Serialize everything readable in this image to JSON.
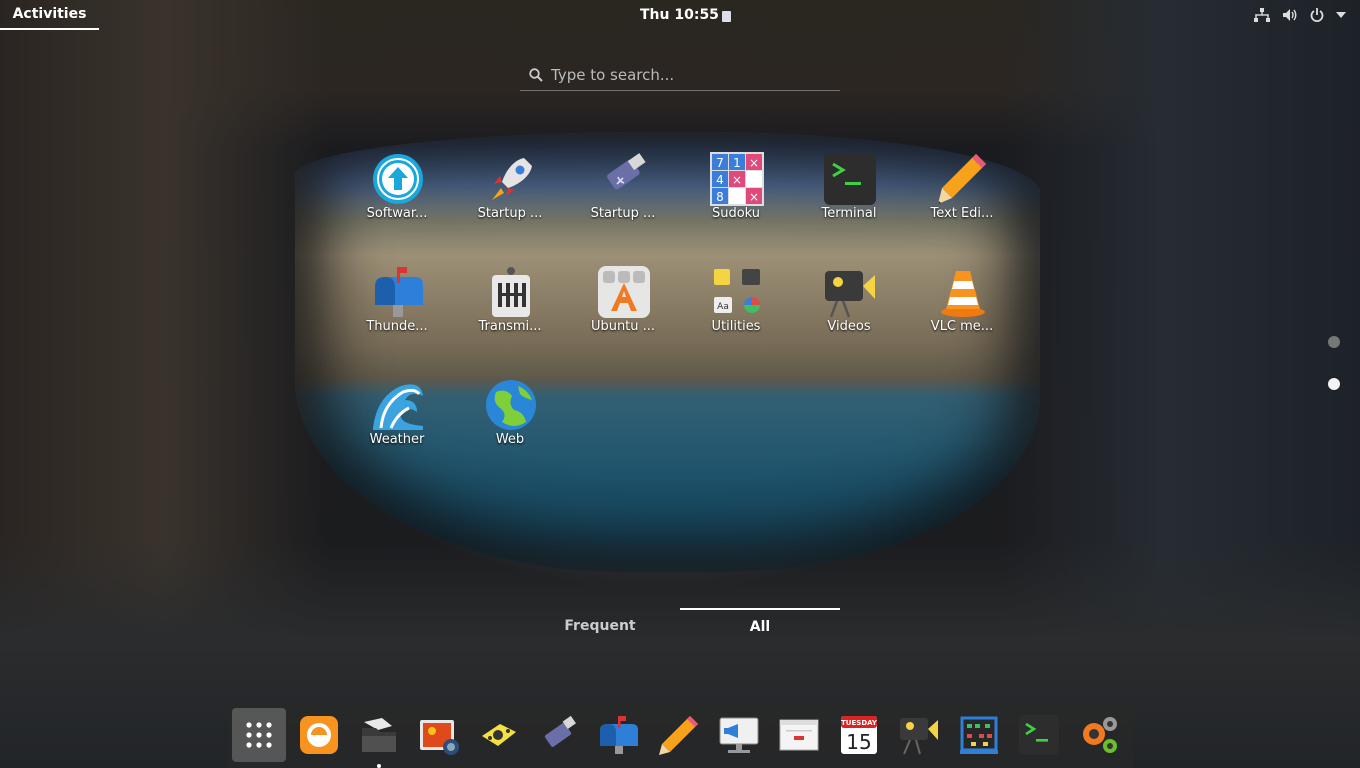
{
  "topbar": {
    "activities": "Activities",
    "clock": "Thu 10:55",
    "tray_icons": [
      "network-icon",
      "volume-icon",
      "power-icon",
      "tray-menu-arrow-icon"
    ]
  },
  "search": {
    "placeholder": "Type to search..."
  },
  "apps": [
    {
      "label": "Softwar...",
      "icon": "software-updater-icon"
    },
    {
      "label": "Startup ...",
      "icon": "startup-rocket-icon"
    },
    {
      "label": "Startup ...",
      "icon": "startup-disk-creator-icon"
    },
    {
      "label": "Sudoku",
      "icon": "sudoku-icon"
    },
    {
      "label": "Terminal",
      "icon": "terminal-icon"
    },
    {
      "label": "Text Edi...",
      "icon": "text-editor-icon"
    },
    {
      "label": "Thunde...",
      "icon": "thunderbird-mailbox-icon"
    },
    {
      "label": "Transmi...",
      "icon": "transmission-icon"
    },
    {
      "label": "Ubuntu ...",
      "icon": "ubuntu-software-icon"
    },
    {
      "label": "Utilities",
      "icon": "utilities-folder-icon"
    },
    {
      "label": "Videos",
      "icon": "videos-icon"
    },
    {
      "label": "VLC me...",
      "icon": "vlc-icon"
    },
    {
      "label": "Weather",
      "icon": "weather-icon"
    },
    {
      "label": "Web",
      "icon": "web-browser-icon"
    }
  ],
  "view_tabs": {
    "frequent": "Frequent",
    "all": "All",
    "active": "All"
  },
  "pages": {
    "count": 2,
    "current": 2
  },
  "dock": [
    {
      "name": "show-applications",
      "icon": "grid-icon"
    },
    {
      "name": "firefox",
      "icon": "firefox-icon"
    },
    {
      "name": "files",
      "icon": "folder-icon",
      "running": true
    },
    {
      "name": "image-viewer",
      "icon": "photo-icon"
    },
    {
      "name": "screenshot",
      "icon": "camera-icon"
    },
    {
      "name": "startup-disk-creator",
      "icon": "usb-icon"
    },
    {
      "name": "thunderbird",
      "icon": "mailbox-icon"
    },
    {
      "name": "text-editor",
      "icon": "pencil-icon"
    },
    {
      "name": "presentation",
      "icon": "presentation-icon"
    },
    {
      "name": "document-viewer",
      "icon": "document-icon"
    },
    {
      "name": "calendar",
      "icon": "calendar-icon",
      "calendar_day": "TUESDAY",
      "calendar_date": "15"
    },
    {
      "name": "videos",
      "icon": "videos-icon"
    },
    {
      "name": "abacus",
      "icon": "abacus-icon"
    },
    {
      "name": "terminal",
      "icon": "terminal-icon"
    },
    {
      "name": "settings",
      "icon": "gears-icon"
    }
  ]
}
